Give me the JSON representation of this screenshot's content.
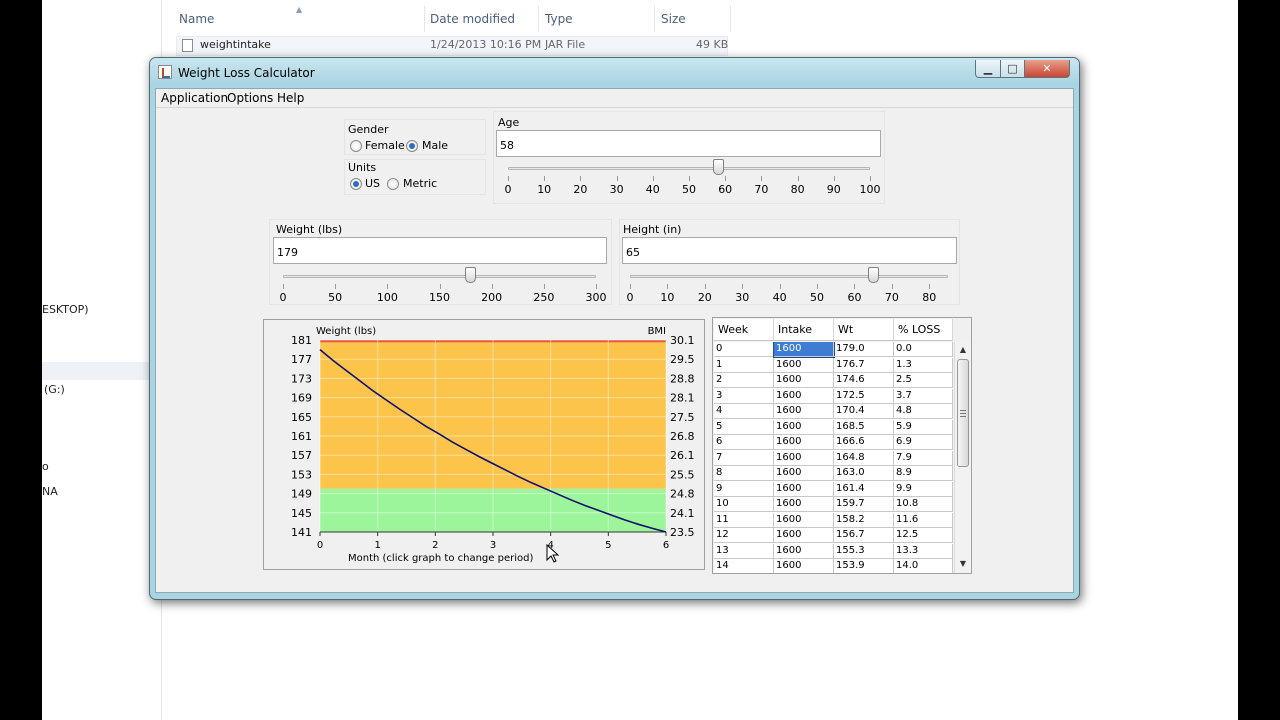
{
  "explorer": {
    "columns": {
      "name": "Name",
      "date_modified": "Date modified",
      "type": "Type",
      "size": "Size"
    },
    "file": {
      "name": "weightintake",
      "date": "1/24/2013 10:16 PM",
      "type": "JAR File",
      "size": "49 KB"
    },
    "nav_partial": [
      "ESKTOP)",
      "(G:)",
      "o",
      "NA"
    ]
  },
  "window": {
    "title": "Weight Loss Calculator",
    "controls": {
      "minimize": "▁",
      "maximize": "□",
      "close": "✕"
    }
  },
  "menu": [
    "Application",
    "Options",
    "Help"
  ],
  "gender": {
    "label": "Gender",
    "options": [
      "Female",
      "Male"
    ],
    "selected": "Male"
  },
  "units": {
    "label": "Units",
    "options": [
      "US",
      "Metric"
    ],
    "selected": "US"
  },
  "age": {
    "label": "Age",
    "value": "58",
    "slider_value": 58,
    "min": 0,
    "max": 100,
    "ticks": [
      "0",
      "10",
      "20",
      "30",
      "40",
      "50",
      "60",
      "70",
      "80",
      "90",
      "100"
    ]
  },
  "weight": {
    "label": "Weight (lbs)",
    "value": "179",
    "slider_value": 179,
    "min": 0,
    "max": 300,
    "ticks": [
      "0",
      "50",
      "100",
      "150",
      "200",
      "250",
      "300"
    ]
  },
  "height": {
    "label": "Height (in)",
    "value": "65",
    "slider_value": 65,
    "min": 0,
    "max": 85,
    "ticks": [
      "0",
      "10",
      "20",
      "30",
      "40",
      "50",
      "60",
      "70",
      "80"
    ]
  },
  "chart_data": {
    "type": "line",
    "ylabel": "Weight (lbs)",
    "ylabel_right": "BMI",
    "xlabel": "Month    (click graph to change period)",
    "x_ticks": [
      "0",
      "1",
      "2",
      "3",
      "4",
      "5",
      "6"
    ],
    "xlim": [
      0,
      6
    ],
    "ylim": [
      141,
      181
    ],
    "y_ticks": [
      "181",
      "177",
      "173",
      "169",
      "165",
      "161",
      "157",
      "153",
      "149",
      "145",
      "141"
    ],
    "y_ticks_right": [
      "30.1",
      "29.5",
      "28.8",
      "28.1",
      "27.5",
      "26.8",
      "26.1",
      "25.5",
      "24.8",
      "24.1",
      "23.5"
    ],
    "bands": [
      {
        "from": 180.5,
        "to": 181,
        "color": "#e85a3c"
      },
      {
        "from": 150,
        "to": 180.5,
        "color": "#fcc44a"
      },
      {
        "from": 141,
        "to": 150,
        "color": "#9cf59a"
      }
    ],
    "series": [
      {
        "color": "#101070",
        "x": [
          0,
          0.23,
          0.46,
          0.69,
          0.92,
          1.15,
          1.38,
          1.61,
          1.84,
          2.07,
          2.3,
          2.53,
          2.76,
          2.99,
          3.22,
          3.45,
          3.68,
          3.91,
          4.14,
          4.37,
          4.6,
          4.83,
          5.06,
          5.29,
          5.52,
          5.75,
          6.0
        ],
        "y": [
          179.0,
          176.7,
          174.6,
          172.5,
          170.4,
          168.5,
          166.6,
          164.8,
          163.0,
          161.4,
          159.7,
          158.2,
          156.7,
          155.3,
          153.9,
          152.5,
          151.2,
          150.0,
          148.8,
          147.6,
          146.5,
          145.5,
          144.5,
          143.5,
          142.6,
          141.8,
          141.0
        ]
      }
    ],
    "grid": true
  },
  "table": {
    "headers": [
      "Week",
      "Intake",
      "Wt",
      "% LOSS"
    ],
    "rows": [
      [
        "0",
        "1600",
        "179.0",
        "0.0"
      ],
      [
        "1",
        "1600",
        "176.7",
        "1.3"
      ],
      [
        "2",
        "1600",
        "174.6",
        "2.5"
      ],
      [
        "3",
        "1600",
        "172.5",
        "3.7"
      ],
      [
        "4",
        "1600",
        "170.4",
        "4.8"
      ],
      [
        "5",
        "1600",
        "168.5",
        "5.9"
      ],
      [
        "6",
        "1600",
        "166.6",
        "6.9"
      ],
      [
        "7",
        "1600",
        "164.8",
        "7.9"
      ],
      [
        "8",
        "1600",
        "163.0",
        "8.9"
      ],
      [
        "9",
        "1600",
        "161.4",
        "9.9"
      ],
      [
        "10",
        "1600",
        "159.7",
        "10.8"
      ],
      [
        "11",
        "1600",
        "158.2",
        "11.6"
      ],
      [
        "12",
        "1600",
        "156.7",
        "12.5"
      ],
      [
        "13",
        "1600",
        "155.3",
        "13.3"
      ],
      [
        "14",
        "1600",
        "153.9",
        "14.0"
      ]
    ],
    "selected_cell": "1600"
  }
}
